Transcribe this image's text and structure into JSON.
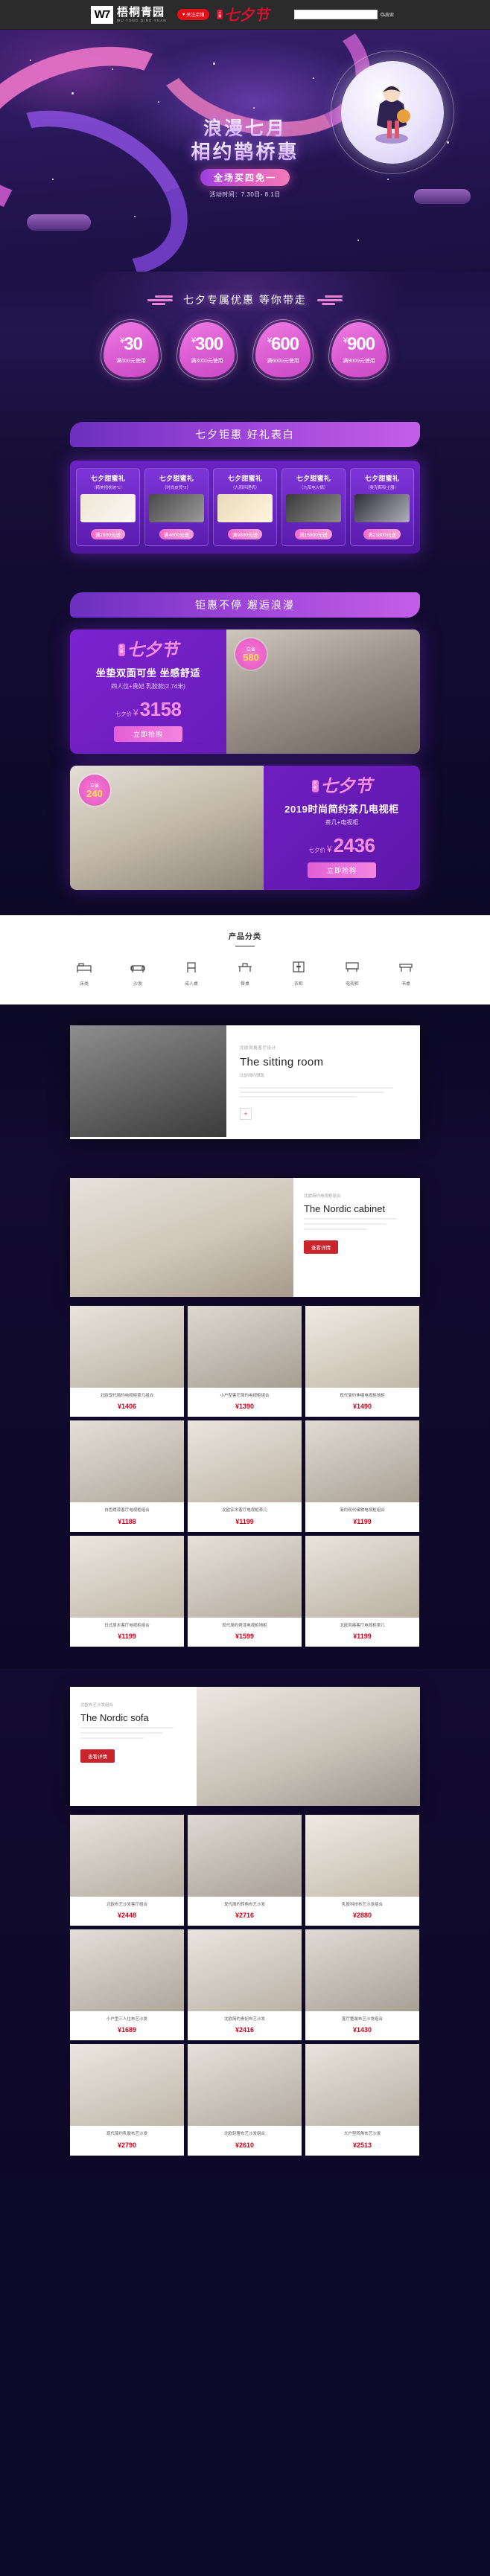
{
  "topbar": {
    "logo_mark": "W7",
    "logo_cn": "梧桐青园",
    "logo_en": "WU TONG QING YUAN",
    "follow_label": "关注店铺",
    "heart_icon": "heart-icon",
    "qixi_badge": "天猫",
    "qixi_script": "七夕节",
    "search_value": "",
    "search_placeholder": "",
    "search_label": "搜索"
  },
  "hero": {
    "title_line1": "浪漫七月",
    "title_line2": "相约鹊桥惠",
    "pill": "全场买四免一",
    "date": "活动时间：7.30日- 8.1日"
  },
  "coupons": {
    "heading": "七夕专属优惠 等你带走",
    "items": [
      {
        "currency": "¥",
        "amount": "30",
        "condition": "满300元使用"
      },
      {
        "currency": "¥",
        "amount": "300",
        "condition": "满3000元使用"
      },
      {
        "currency": "¥",
        "amount": "600",
        "condition": "满6000元使用"
      },
      {
        "currency": "¥",
        "amount": "900",
        "condition": "满9000元使用"
      }
    ]
  },
  "gifts": {
    "heading": "七夕钜惠 好礼表白",
    "items": [
      {
        "title": "七夕甜蜜礼",
        "sub": "（精美抱枕被*1）",
        "tag": "满2800元送"
      },
      {
        "title": "七夕甜蜜礼",
        "sub": "（时尚皮凳*2）",
        "tag": "满4800元送"
      },
      {
        "title": "七夕甜蜜礼",
        "sub": "（九阳料理机）",
        "tag": "满9800元送"
      },
      {
        "title": "七夕甜蜜礼",
        "sub": "（九阳电火锅）",
        "tag": "满15800元送"
      },
      {
        "title": "七夕甜蜜礼",
        "sub": "（奥克斯吸尘器）",
        "tag": "满23800元送"
      }
    ]
  },
  "promos": {
    "heading": "钜惠不停 邂逅浪漫",
    "items": [
      {
        "badge_top": "立省",
        "badge_amount": "580",
        "qixi_badge": "天猫",
        "qixi_script": "七夕节",
        "headline": "坐垫双面可坐 坐感舒适",
        "sub": "四人位+贵妃  乳胶款(2.74米)",
        "price_label": "七夕价",
        "currency": "¥",
        "price": "3158",
        "button": "立即抢购"
      },
      {
        "badge_top": "立省",
        "badge_amount": "240",
        "qixi_badge": "天猫",
        "qixi_script": "七夕节",
        "headline": "2019时尚简约茶几电视柜",
        "sub": "茶几+电视柜",
        "price_label": "七夕价",
        "currency": "¥",
        "price": "2436",
        "button": "立即抢购"
      }
    ]
  },
  "categories": {
    "title": "产品分类",
    "items": [
      {
        "icon": "bed-icon",
        "label": "床类"
      },
      {
        "icon": "sofa-icon",
        "label": "沙发"
      },
      {
        "icon": "chair-icon",
        "label": "成人桌"
      },
      {
        "icon": "table-icon",
        "label": "餐桌"
      },
      {
        "icon": "wardrobe-icon",
        "label": "衣柜"
      },
      {
        "icon": "cabinet-icon",
        "label": "电视柜"
      },
      {
        "icon": "desk-icon",
        "label": "书桌"
      }
    ]
  },
  "editorial": {
    "kicker": "北欧风格客厅设计",
    "title": "The sitting room",
    "sub": "北欧简约雅致",
    "more_icon": "plus-icon"
  },
  "feature_cabinet": {
    "kicker": "北欧简约电视柜组合",
    "title": "The Nordic cabinet",
    "button": "查看详情"
  },
  "feature_sofa": {
    "kicker": "北欧布艺沙发组合",
    "title": "The Nordic sofa",
    "button": "查看详情"
  },
  "products_cabinet": [
    {
      "name": "北欧现代简约电视柜茶几组合",
      "price": "¥1406"
    },
    {
      "name": "小户型客厅简约电视柜组合",
      "price": "¥1390"
    },
    {
      "name": "现代简约伸缩电视柜地柜",
      "price": "¥1490"
    },
    {
      "name": "白色烤漆客厅电视柜组合",
      "price": "¥1188"
    },
    {
      "name": "北欧实木客厅电视柜茶几",
      "price": "¥1199"
    },
    {
      "name": "简约现代储物电视柜组合",
      "price": "¥1199"
    },
    {
      "name": "日式原木客厅电视柜组合",
      "price": "¥1199"
    },
    {
      "name": "现代简约烤漆电视柜地柜",
      "price": "¥1599"
    },
    {
      "name": "北欧风格客厅电视柜茶几",
      "price": "¥1199"
    }
  ],
  "products_sofa": [
    {
      "name": "北欧布艺沙发客厅组合",
      "price": "¥2448"
    },
    {
      "name": "现代简约转角布艺沙发",
      "price": "¥2716"
    },
    {
      "name": "乳胶科技布艺沙发组合",
      "price": "¥2880"
    },
    {
      "name": "小户型三人位布艺沙发",
      "price": "¥1689"
    },
    {
      "name": "北欧简约贵妃布艺沙发",
      "price": "¥2416"
    },
    {
      "name": "客厅整装布艺沙发组合",
      "price": "¥1430"
    },
    {
      "name": "现代简约乳胶布艺沙发",
      "price": "¥2790"
    },
    {
      "name": "北欧轻奢布艺沙发组合",
      "price": "¥2610"
    },
    {
      "name": "大户型转角布艺沙发",
      "price": "¥2513"
    }
  ]
}
